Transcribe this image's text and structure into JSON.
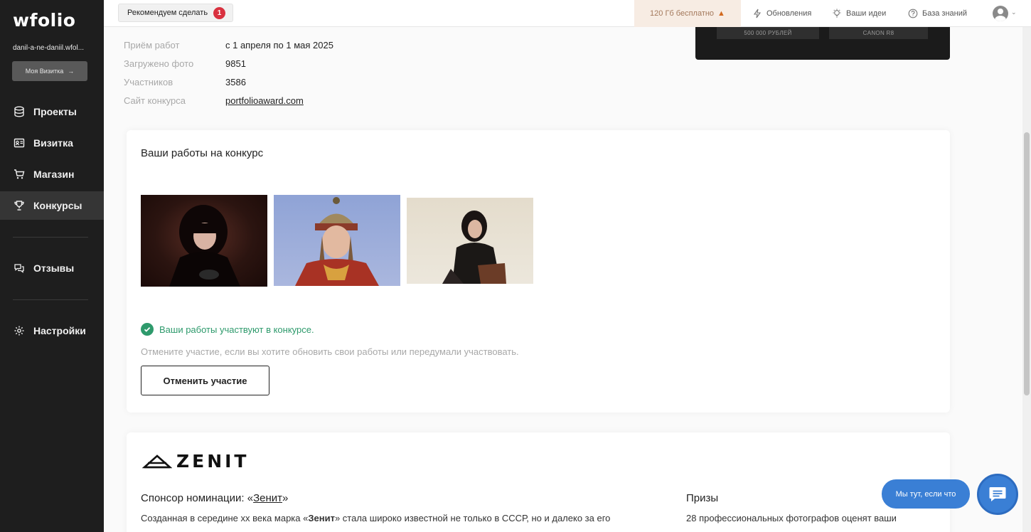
{
  "sidebar": {
    "logo": "wfolio",
    "domain": "danil-a-ne-daniil.wfol...",
    "card_button": "Моя Визитка",
    "items": [
      {
        "label": "Проекты",
        "icon": "database-icon"
      },
      {
        "label": "Визитка",
        "icon": "id-card-icon"
      },
      {
        "label": "Магазин",
        "icon": "cart-icon"
      },
      {
        "label": "Конкурсы",
        "icon": "trophy-icon",
        "active": true
      },
      {
        "label": "Отзывы",
        "icon": "chat-bubbles-icon"
      },
      {
        "label": "Настройки",
        "icon": "gear-icon"
      }
    ]
  },
  "topbar": {
    "recommend_label": "Рекомендуем сделать",
    "recommend_count": "1",
    "free_gb": "120 Гб бесплатно",
    "updates": "Обновления",
    "ideas": "Ваши идеи",
    "knowledge": "База знаний"
  },
  "banner": {
    "box1": "500 000 РУБЛЕЙ",
    "box2": "CANON R8"
  },
  "contest_info": {
    "rows": [
      {
        "label": "Приём работ",
        "value": "с 1 апреля по 1 мая 2025"
      },
      {
        "label": "Загружено фото",
        "value": "9851"
      },
      {
        "label": "Участников",
        "value": "3586"
      },
      {
        "label": "Сайт конкурса",
        "value": "portfolioaward.com"
      }
    ]
  },
  "works": {
    "title": "Ваши работы на конкурс",
    "status": "Ваши работы участвуют в конкурсе.",
    "hint": "Отмените участие, если вы хотите обновить свои работы или передумали участвовать.",
    "cancel_button": "Отменить участие"
  },
  "sponsor": {
    "logo_text": "ZENIT",
    "title_prefix": "Спонсор номинации: «",
    "title_link": "Зенит",
    "title_suffix": "»",
    "desc_start": "Созданная в середине хх века марка «",
    "desc_bold": "Зенит",
    "desc_end": "» стала широко известной не только в СССР, но и далеко за его",
    "prizes_title": "Призы",
    "prizes_desc": "28 профессиональных фотографов оценят ваши"
  },
  "chat": {
    "bubble": "Мы тут, если что"
  },
  "colors": {
    "sidebar_bg": "#1e1e1e",
    "accent_green": "#2e9a6c",
    "badge_red": "#d9313f",
    "chat_blue": "#3a7fd5",
    "free_gb_bg": "#f7ece3"
  }
}
